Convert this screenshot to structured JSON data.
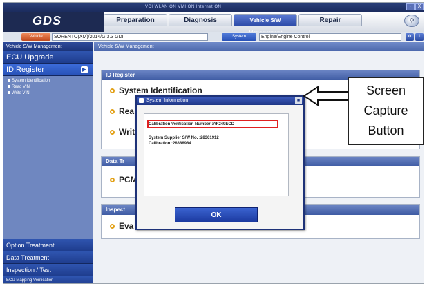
{
  "statusbar": {
    "windows": "VCI  WLAN ON  VMI  ON  Internet  ON",
    "win_buttons": [
      "-",
      "X"
    ]
  },
  "header": {
    "logo": "GDS",
    "tabs": [
      {
        "label": "Preparation",
        "active": false
      },
      {
        "label": "Diagnosis",
        "active": false
      },
      {
        "label": "Vehicle S/W Management",
        "active": true
      },
      {
        "label": "Repair",
        "active": false
      }
    ]
  },
  "vehbar": {
    "vehicle_button": "Vehicle",
    "vehicle_value": "SORENTO(XM)/2014/G 3.3 GDI",
    "system_button": "System",
    "system_value": "Engine/Engine Control"
  },
  "sidebar": {
    "header": "Vehicle S/W Management",
    "items": [
      {
        "label": "ECU Upgrade"
      },
      {
        "label": "ID Register"
      }
    ],
    "subitems": [
      "System Identification",
      "Read VIN",
      "Write VIN"
    ],
    "bottom": [
      "Option Treatment",
      "Data Treatment",
      "Inspection / Test"
    ],
    "bottom_small": "ECU Mapping Verification"
  },
  "content": {
    "breadcrumb": "Vehicle S/W Management",
    "panel1_title": "ID Register",
    "items": [
      "System Identification",
      "Rea",
      "Writ"
    ],
    "panel2_title": "Data Tr",
    "panel2_item": "PCM",
    "panel3_title": "Inspect",
    "panel3_item": "Eva"
  },
  "dialog": {
    "title": "System Information",
    "lines": [
      "Calibration Verification Number :AF249ECD",
      "System Supplier S/W No. :28361912",
      "Calibration :28388984"
    ],
    "ok": "OK"
  },
  "callout": {
    "lines": [
      "Screen",
      "Capture",
      "Button"
    ]
  }
}
